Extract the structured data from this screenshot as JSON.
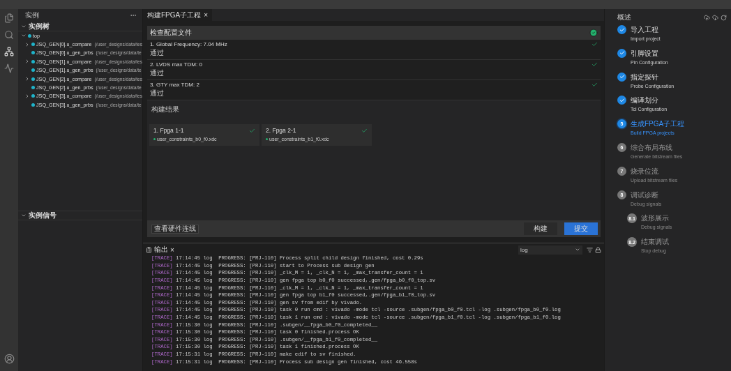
{
  "sidebar": {
    "title": "实例",
    "tree_section": {
      "title": "实例树",
      "expanded": true
    },
    "tree": {
      "name": "top",
      "expanded": true,
      "children": [
        {
          "kind": "branch",
          "expanded": false,
          "name": "JSQ_GEN[0].u_compare",
          "path": "(/user_designs/data/tes"
        },
        {
          "kind": "leaf",
          "name": "JSQ_GEN[0].u_gen_prbs",
          "path": "(/user_designs/data/te"
        },
        {
          "kind": "branch",
          "expanded": false,
          "name": "JSQ_GEN[1].u_compare",
          "path": "(/user_designs/data/tes"
        },
        {
          "kind": "leaf",
          "name": "JSQ_GEN[1].u_gen_prbs",
          "path": "(/user_designs/data/te"
        },
        {
          "kind": "branch",
          "expanded": false,
          "name": "JSQ_GEN[2].u_compare",
          "path": "(/user_designs/data/tes"
        },
        {
          "kind": "leaf",
          "name": "JSQ_GEN[2].u_gen_prbs",
          "path": "(/user_designs/data/te"
        },
        {
          "kind": "branch",
          "expanded": false,
          "name": "JSQ_GEN[3].u_compare",
          "path": "(/user_designs/data/tes"
        },
        {
          "kind": "leaf",
          "name": "JSQ_GEN[3].u_gen_prbs",
          "path": "(/user_designs/data/te"
        }
      ]
    },
    "signal_section": {
      "title": "实例信号",
      "expanded": true
    }
  },
  "editor_tab": {
    "title": "构建FPGA子工程",
    "close": "×"
  },
  "check": {
    "title": "检查配置文件",
    "passed": true,
    "items": [
      {
        "label": "1. Global Frequency: 7.04 MHz",
        "note": "通过",
        "passed": true
      },
      {
        "label": "2. LVDS max TDM: 0",
        "note": "通过",
        "passed": true
      },
      {
        "label": "3. GTY max TDM: 2",
        "note": "通过",
        "passed": true
      }
    ]
  },
  "results": {
    "title": "构建结果",
    "cards": [
      {
        "title": "1. Fpga 1-1",
        "file": "user_constraints_b0_f0.xdc",
        "passed": true
      },
      {
        "title": "2. Fpga 2-1",
        "file": "user_constraints_b1_f0.xdc",
        "passed": true
      }
    ]
  },
  "footer": {
    "link_button": "查看硬件连线",
    "buttons": [
      {
        "label": "构建",
        "primary": false
      },
      {
        "label": "提交",
        "primary": true
      }
    ]
  },
  "output": {
    "tab": "输出",
    "close": "×",
    "filter": "log",
    "lines": [
      {
        "tag": "[TRACE]",
        "text": "17:14:45 log  PROGRESS: [PRJ-110] Process split child design finished, cost 0.29s"
      },
      {
        "tag": "[TRACE]",
        "text": "17:14:45 log  PROGRESS: [PRJ-110] start to Process sub design gen"
      },
      {
        "tag": "[TRACE]",
        "text": "17:14:45 log  PROGRESS: [PRJ-110] _clk_M = 1, _clk_N = 1, _max_transfer_count = 1"
      },
      {
        "tag": "[TRACE]",
        "text": "17:14:45 log  PROGRESS: [PRJ-110] gen fpga top b0_f0 successed,.gen/fpga_b0_f0_top.sv"
      },
      {
        "tag": "[TRACE]",
        "text": "17:14:45 log  PROGRESS: [PRJ-110] _clk_M = 1, _clk_N = 1, _max_transfer_count = 1"
      },
      {
        "tag": "[TRACE]",
        "text": "17:14:45 log  PROGRESS: [PRJ-110] gen fpga top b1_f0 successed,.gen/fpga_b1_f0_top.sv"
      },
      {
        "tag": "[TRACE]",
        "text": "17:14:45 log  PROGRESS: [PRJ-110] gen sv from edif by vivado."
      },
      {
        "tag": "[TRACE]",
        "text": "17:14:45 log  PROGRESS: [PRJ-110] task 0 run cmd : vivado -mode tcl -source .subgen/fpga_b0_f0.tcl -log .subgen/fpga_b0_f0.log"
      },
      {
        "tag": "[TRACE]",
        "text": "17:14:45 log  PROGRESS: [PRJ-110] task 1 run cmd : vivado -mode tcl -source .subgen/fpga_b1_f0.tcl -log .subgen/fpga_b1_f0.log"
      },
      {
        "tag": "[TRACE]",
        "text": "17:15:30 log  PROGRESS: [PRJ-110] .subgen/__fpga_b0_f0_completed__"
      },
      {
        "tag": "[TRACE]",
        "text": "17:15:30 log  PROGRESS: [PRJ-110] task 0 finished.process OK"
      },
      {
        "tag": "[TRACE]",
        "text": "17:15:30 log  PROGRESS: [PRJ-110] .subgen/__fpga_b1_f0_completed__"
      },
      {
        "tag": "[TRACE]",
        "text": "17:15:30 log  PROGRESS: [PRJ-110] task 1 finished.process OK"
      },
      {
        "tag": "[TRACE]",
        "text": "17:15:31 log  PROGRESS: [PRJ-110] make edif to sv finished."
      },
      {
        "tag": "[TRACE]",
        "text": "17:15:31 log  PROGRESS: [PRJ-110] Process sub design gen finished, cost 46.558s"
      }
    ]
  },
  "overview": {
    "title": "概述",
    "steps": [
      {
        "done": true,
        "selected": false,
        "title": "导入工程",
        "subtitle": "Import project"
      },
      {
        "done": true,
        "selected": false,
        "title": "引脚设置",
        "subtitle": "Pin Configuration"
      },
      {
        "done": true,
        "selected": false,
        "title": "指定探针",
        "subtitle": "Probe Configuration"
      },
      {
        "done": true,
        "selected": false,
        "title": "编译划分",
        "subtitle": "Tcl Configuration"
      },
      {
        "done": false,
        "selected": true,
        "number": "5",
        "title": "生成FPGA子工程",
        "subtitle": "Build FPGA projects"
      },
      {
        "done": false,
        "selected": false,
        "number": "6",
        "title": "综合布局布线",
        "subtitle": "Generate bitstream files"
      },
      {
        "done": false,
        "selected": false,
        "number": "7",
        "title": "烧录位流",
        "subtitle": "Upload bitstream files"
      },
      {
        "done": false,
        "selected": false,
        "number": "8",
        "title": "调试诊断",
        "subtitle": "Debug signals",
        "children": [
          {
            "done": false,
            "selected": false,
            "number": "8.1",
            "title": "波形展示",
            "subtitle": "Debug signals"
          },
          {
            "done": false,
            "selected": false,
            "number": "8.2",
            "title": "结束调试",
            "subtitle": "Stop debug"
          }
        ]
      }
    ]
  }
}
